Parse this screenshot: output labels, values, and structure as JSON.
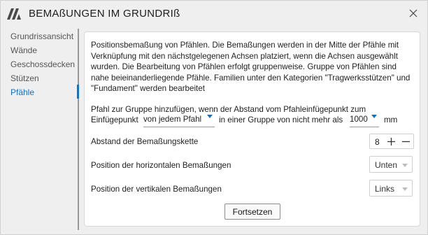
{
  "window": {
    "title": "BEMAßUNGEN IM GRUNDRIß",
    "logo_icon": "app-logo-icon",
    "close_icon": "close-icon"
  },
  "sidebar": {
    "items": [
      {
        "label": "Grundrissansicht",
        "active": false
      },
      {
        "label": "Wände",
        "active": false
      },
      {
        "label": "Geschossdecken",
        "active": false
      },
      {
        "label": "Stützen",
        "active": false
      },
      {
        "label": "Pfähle",
        "active": true
      }
    ],
    "accent": "#1a6fb5"
  },
  "panel": {
    "description": "Positionsbemaßung von Pfählen. Die Bemaßungen werden in der Mitte der Pfähle mit Verknüpfung mit den nächstgelegenen Achsen platziert, wenn die Achsen ausgewählt wurden. Die Bearbeitung von Pfählen erfolgt gruppenweise. Gruppe von Pfählen sind nahe beieinanderliegende Pfähle. Familien unter den Kategorien \"Tragwerksstützen\" und \"Fundament\" werden bearbeitet",
    "group_line1": "Pfahl zur Gruppe hinzufügen, wenn der Abstand vom Pfahleinfügepunkt zum",
    "group_prefix": "Einfügepunkt",
    "group_dropdown": "von jedem Pfahl",
    "group_middle": "in einer Gruppe von nicht mehr als",
    "distance_dropdown": "1000",
    "distance_unit": "mm",
    "chain_label": "Abstand der Bemaßungskette",
    "chain_value": "8",
    "horizontal_label": "Position der horizontalen Bemaßungen",
    "horizontal_value": "Unten",
    "vertical_label": "Position der vertikalen Bemaßungen",
    "vertical_value": "Links",
    "continue_label": "Fortsetzen"
  }
}
